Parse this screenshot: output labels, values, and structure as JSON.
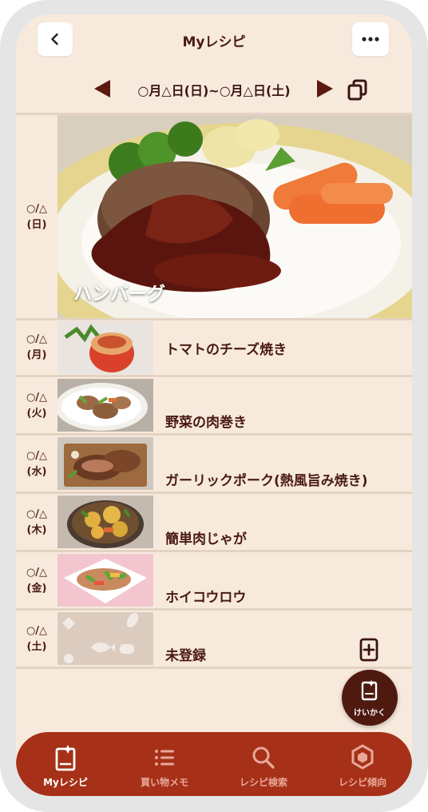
{
  "header": {
    "title": "Myレシピ",
    "back_icon": "chevron-left-icon",
    "menu_icon": "more-horizontal-icon"
  },
  "week": {
    "range": "○月△日(日)~○月△日(土)"
  },
  "days": [
    {
      "date": "○/△",
      "weekday": "(日)",
      "recipe": "ハンバーグ"
    },
    {
      "date": "○/△",
      "weekday": "(月)",
      "recipe": "トマトのチーズ焼き"
    },
    {
      "date": "○/△",
      "weekday": "(火)",
      "recipe": "野菜の肉巻き"
    },
    {
      "date": "○/△",
      "weekday": "(水)",
      "recipe": "ガーリックポーク(熱風旨み焼き)"
    },
    {
      "date": "○/△",
      "weekday": "(木)",
      "recipe": "簡単肉じゃが"
    },
    {
      "date": "○/△",
      "weekday": "(金)",
      "recipe": "ホイコウロウ"
    },
    {
      "date": "○/△",
      "weekday": "(土)",
      "recipe": "未登録"
    }
  ],
  "fab": {
    "label": "けいかく"
  },
  "nav": [
    {
      "label": "Myレシピ",
      "icon": "my-recipe-icon",
      "active": true
    },
    {
      "label": "買い物メモ",
      "icon": "list-icon",
      "active": false
    },
    {
      "label": "レシピ検索",
      "icon": "search-icon",
      "active": false
    },
    {
      "label": "レシピ傾向",
      "icon": "hexagon-icon",
      "active": false
    }
  ],
  "colors": {
    "background": "#f7eadd",
    "accent": "#a63018",
    "text": "#4a1a12",
    "nav_inactive": "#e8a89a"
  }
}
